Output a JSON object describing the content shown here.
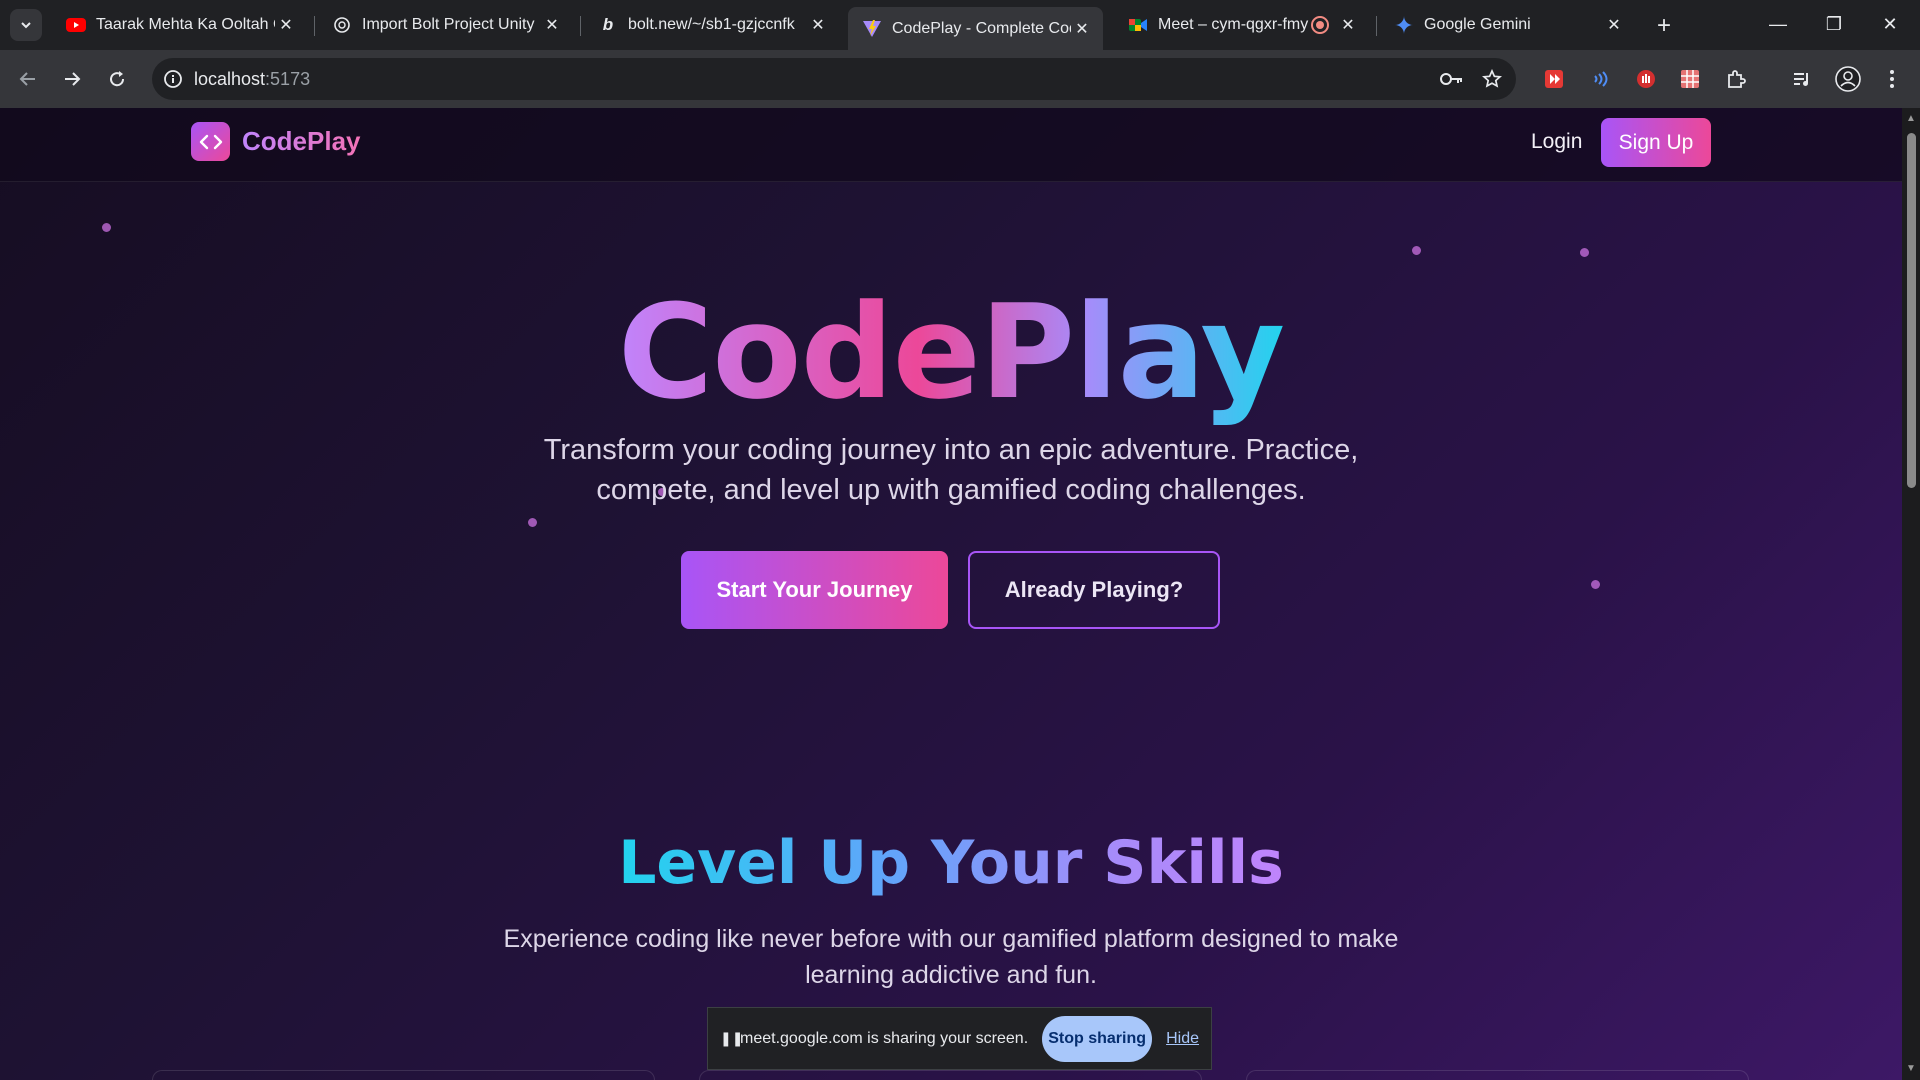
{
  "browser": {
    "tabs": [
      {
        "title": "Taarak Mehta Ka Ooltah Ch",
        "icon": "youtube-icon"
      },
      {
        "title": "Import Bolt Project Unity",
        "icon": "openai-icon"
      },
      {
        "title": "bolt.new/~/sb1-gzjccnfk",
        "icon": "bolt-icon"
      },
      {
        "title": "CodePlay - Complete Codi",
        "icon": "vite-icon",
        "active": true
      },
      {
        "title": "Meet – cym-qgxr-fmy",
        "icon": "google-meet-icon"
      },
      {
        "title": "Google Gemini",
        "icon": "gemini-icon"
      }
    ],
    "url_host": "localhost",
    "url_port": ":5173"
  },
  "nav": {
    "brand": "CodePlay",
    "login": "Login",
    "signup": "Sign Up"
  },
  "hero": {
    "title": "CodePlay",
    "subtitle": "Transform your coding journey into an epic adventure. Practice, compete, and level up with gamified coding challenges.",
    "primary_cta": "Start Your Journey",
    "secondary_cta": "Already Playing?"
  },
  "features": {
    "title": "Level Up Your Skills",
    "subtitle": "Experience coding like never before with our gamified platform designed to make learning addictive and fun."
  },
  "sharebar": {
    "message": "meet.google.com is sharing your screen.",
    "stop": "Stop sharing",
    "hide": "Hide"
  },
  "colors": {
    "accent_purple": "#a855f7",
    "accent_pink": "#ec4899",
    "accent_cyan": "#22d3ee"
  }
}
